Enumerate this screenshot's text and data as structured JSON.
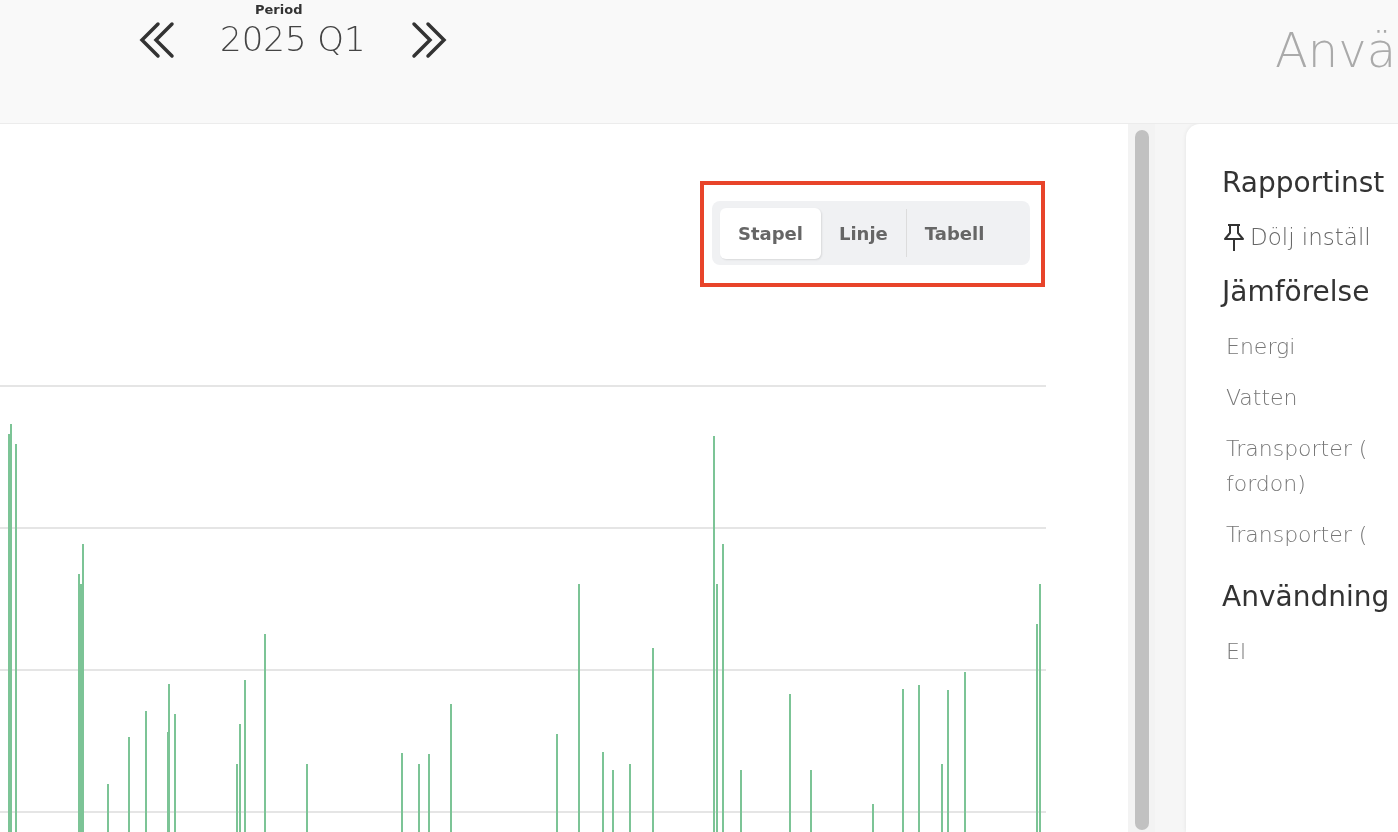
{
  "period": {
    "label": "Period",
    "value": "2025 Q1"
  },
  "page_title": "Anvä",
  "chart": {
    "kind": "picture",
    "views": [
      {
        "label": "Stapel",
        "selected": true
      },
      {
        "label": "Linje",
        "selected": false
      },
      {
        "label": "Tabell",
        "selected": false
      }
    ]
  },
  "settings": {
    "title": "Rapportinst",
    "hide_link": "Dölj inställ",
    "sections": [
      {
        "title": "Jämförelse",
        "items": [
          {
            "label": "Energi"
          },
          {
            "label": "Vatten"
          },
          {
            "label": "Transporter (",
            "line2": "fordon)"
          },
          {
            "label": "Transporter ("
          }
        ]
      },
      {
        "title": "Användning",
        "items": [
          {
            "label": "El"
          }
        ]
      }
    ]
  }
}
